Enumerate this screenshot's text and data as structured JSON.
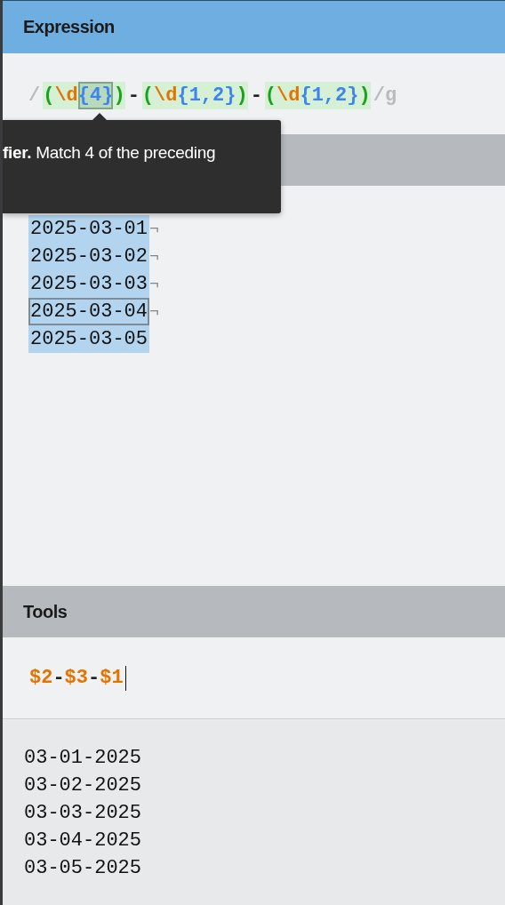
{
  "expression": {
    "title": "Expression",
    "tokens": [
      {
        "kind": "delim",
        "text": "/"
      },
      {
        "kind": "group",
        "children": [
          {
            "kind": "paren",
            "text": "(",
            "selected": false
          },
          {
            "kind": "escape",
            "text": "\\d",
            "selected": false
          },
          {
            "kind": "quant",
            "text": "{4}",
            "selected": true
          },
          {
            "kind": "paren",
            "text": ")",
            "selected": false
          }
        ]
      },
      {
        "kind": "literal",
        "text": "-"
      },
      {
        "kind": "group",
        "children": [
          {
            "kind": "paren",
            "text": "(",
            "selected": false
          },
          {
            "kind": "escape",
            "text": "\\d",
            "selected": false
          },
          {
            "kind": "quant",
            "text": "{1,2}",
            "selected": false
          },
          {
            "kind": "paren",
            "text": ")",
            "selected": false
          }
        ]
      },
      {
        "kind": "literal",
        "text": "-"
      },
      {
        "kind": "group",
        "children": [
          {
            "kind": "paren",
            "text": "(",
            "selected": false
          },
          {
            "kind": "escape",
            "text": "\\d",
            "selected": false
          },
          {
            "kind": "quant",
            "text": "{1,2}",
            "selected": false
          },
          {
            "kind": "paren",
            "text": ")",
            "selected": false
          }
        ]
      },
      {
        "kind": "delim",
        "text": "/"
      },
      {
        "kind": "flags",
        "text": "g"
      }
    ]
  },
  "tooltip": {
    "text": "**fier.** Match 4 of the preceding"
  },
  "text": {
    "lines": [
      {
        "text": "2025-03-01",
        "end_mark": "¬",
        "selected": false
      },
      {
        "text": "2025-03-02",
        "end_mark": "¬",
        "selected": false
      },
      {
        "text": "2025-03-03",
        "end_mark": "¬",
        "selected": false
      },
      {
        "text": "2025-03-04",
        "end_mark": "¬",
        "selected": true
      },
      {
        "text": "2025-03-05",
        "selected": false
      }
    ]
  },
  "tools": {
    "title": "Tools",
    "replace_tokens": [
      {
        "kind": "ref",
        "text": "$2"
      },
      {
        "kind": "literal",
        "text": "-"
      },
      {
        "kind": "ref",
        "text": "$3"
      },
      {
        "kind": "literal",
        "text": "-"
      },
      {
        "kind": "ref",
        "text": "$1"
      }
    ],
    "result_lines": [
      "03-01-2025",
      "03-02-2025",
      "03-03-2025",
      "03-04-2025",
      "03-05-2025"
    ]
  }
}
